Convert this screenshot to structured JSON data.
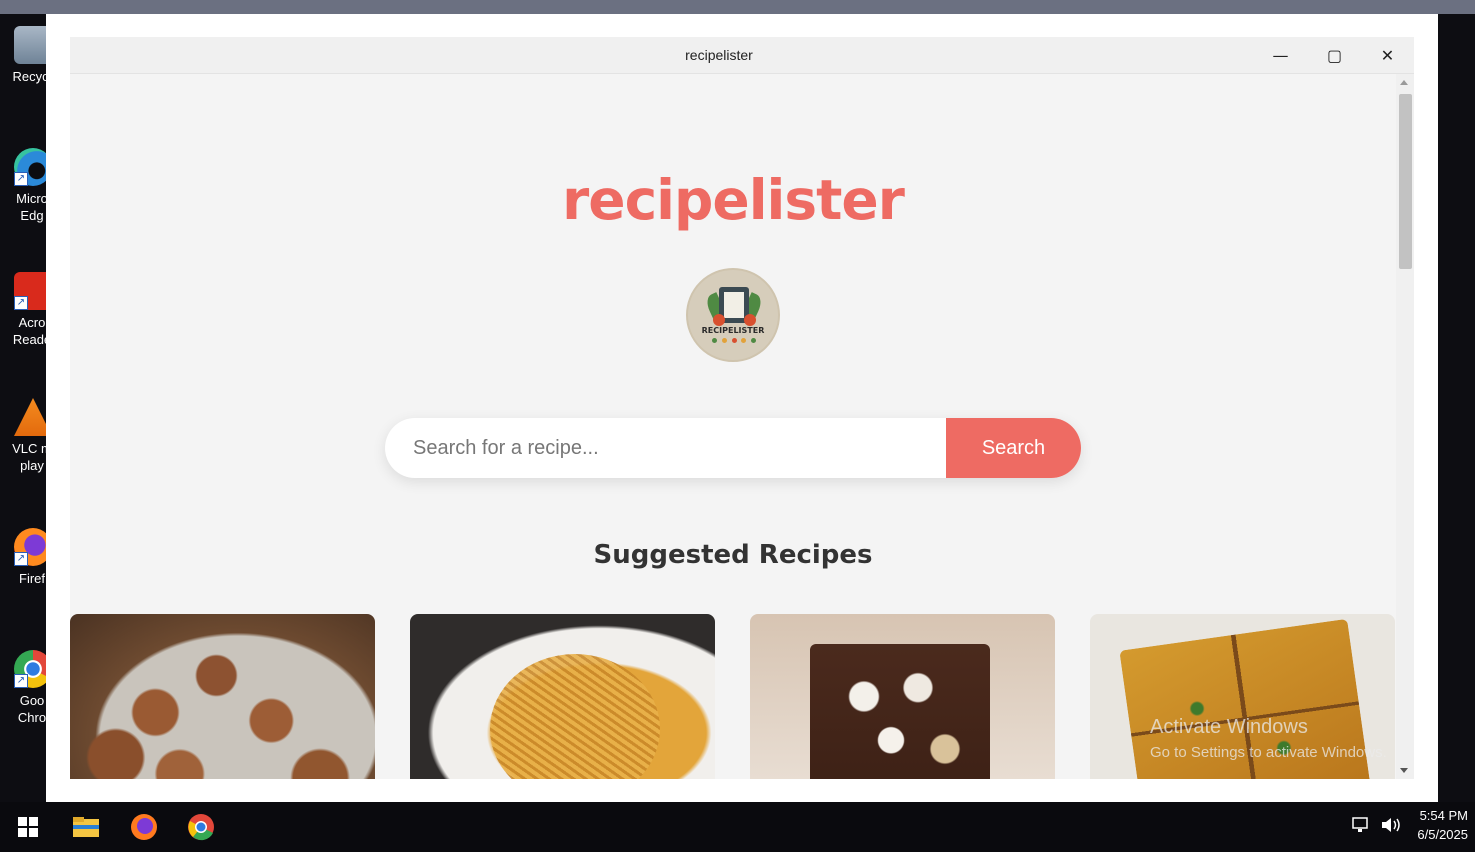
{
  "desktop": {
    "icons": [
      {
        "label": "Recycl",
        "icon": "recycle-bin-icon"
      },
      {
        "label": "Micro\nEdg",
        "icon": "edge-icon"
      },
      {
        "label": "Acro\nReade",
        "icon": "acrobat-icon"
      },
      {
        "label": "VLC m\nplay",
        "icon": "vlc-icon"
      },
      {
        "label": "Firef",
        "icon": "firefox-icon"
      },
      {
        "label": "Goo\nChro",
        "icon": "chrome-icon"
      }
    ]
  },
  "window": {
    "title": "recipelister",
    "controls": {
      "minimize": "—",
      "maximize": "▢",
      "close": "✕"
    }
  },
  "app": {
    "brand": "recipelister",
    "logo_text": "RECIPELISTER",
    "search": {
      "placeholder": "Search for a recipe...",
      "value": "",
      "button_label": "Search"
    },
    "section_title": "Suggested Recipes",
    "cards": [
      {
        "image": "falafel-photo"
      },
      {
        "image": "pasta-photo"
      },
      {
        "image": "rocky-road-photo"
      },
      {
        "image": "toast-photo"
      }
    ]
  },
  "watermark": {
    "title": "Activate Windows",
    "subtitle": "Go to Settings to activate Windows."
  },
  "taskbar": {
    "items": [
      "windows-start-icon",
      "file-explorer-icon",
      "firefox-icon",
      "chrome-icon"
    ],
    "time": "5:54 PM",
    "date": "6/5/2025"
  }
}
